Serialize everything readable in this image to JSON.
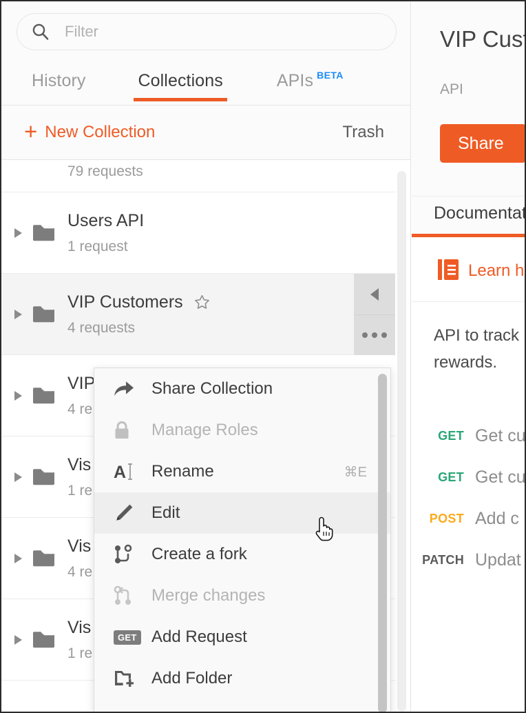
{
  "sidebar": {
    "search": {
      "value": "",
      "placeholder": "Filter",
      "icon": "search-icon"
    },
    "tabs": [
      {
        "label": "History",
        "active": false
      },
      {
        "label": "Collections",
        "active": true
      },
      {
        "label": "APIs",
        "active": false,
        "badge": "BETA"
      }
    ],
    "toolbar": {
      "new_collection_label": "New Collection",
      "new_collection_icon": "plus-icon",
      "trash_label": "Trash"
    },
    "partial_row": {
      "subtitle": "79 requests"
    },
    "collections": [
      {
        "title": "Users API",
        "subtitle": "1 request",
        "selected": false,
        "starred": false
      },
      {
        "title": "VIP Customers",
        "subtitle": "4 requests",
        "selected": true,
        "starred": true
      },
      {
        "title": "VIP",
        "subtitle": "4 re",
        "selected": false,
        "starred": false
      },
      {
        "title": "Vis",
        "subtitle": "1 re",
        "selected": false,
        "starred": false
      },
      {
        "title": "Vis",
        "subtitle": "4 re",
        "selected": false,
        "starred": false
      },
      {
        "title": "Vis",
        "subtitle": "1 re",
        "selected": false,
        "starred": false
      }
    ]
  },
  "context_menu": {
    "items": [
      {
        "label": "Share Collection",
        "icon": "share-arrow-icon",
        "shortcut": "",
        "disabled": false,
        "hover": false
      },
      {
        "label": "Manage Roles",
        "icon": "lock-icon",
        "shortcut": "",
        "disabled": true,
        "hover": false
      },
      {
        "label": "Rename",
        "icon": "text-cursor-icon",
        "shortcut": "⌘E",
        "disabled": false,
        "hover": false
      },
      {
        "label": "Edit",
        "icon": "pencil-icon",
        "shortcut": "",
        "disabled": false,
        "hover": true
      },
      {
        "label": "Create a fork",
        "icon": "fork-icon",
        "shortcut": "",
        "disabled": false,
        "hover": false
      },
      {
        "label": "Merge changes",
        "icon": "merge-icon",
        "shortcut": "",
        "disabled": true,
        "hover": false
      },
      {
        "label": "Add Request",
        "icon": "get-badge-icon",
        "shortcut": "",
        "disabled": false,
        "hover": false
      },
      {
        "label": "Add Folder",
        "icon": "folder-plus-icon",
        "shortcut": "",
        "disabled": false,
        "hover": false
      }
    ]
  },
  "right_panel": {
    "title": "VIP Cust",
    "subtitle": "API",
    "share_label": "Share",
    "tab_label": "Documentat",
    "learn_label": "Learn h",
    "learn_icon": "book-icon",
    "description_line1": "API to track",
    "description_line2": "rewards.",
    "requests": [
      {
        "method": "GET",
        "name": "Get cu"
      },
      {
        "method": "GET",
        "name": "Get cu"
      },
      {
        "method": "POST",
        "name": "Add c"
      },
      {
        "method": "PATCH",
        "name": "Updat"
      }
    ]
  },
  "colors": {
    "accent_orange": "#ef5b25",
    "beta_blue": "#1b8bf9",
    "get_green": "#2ba676",
    "post_amber": "#fcaa1c",
    "patch_gray": "#5a5a5a",
    "selected_row": "#f4f4f4",
    "menu_bg": "#f9f9f9"
  }
}
